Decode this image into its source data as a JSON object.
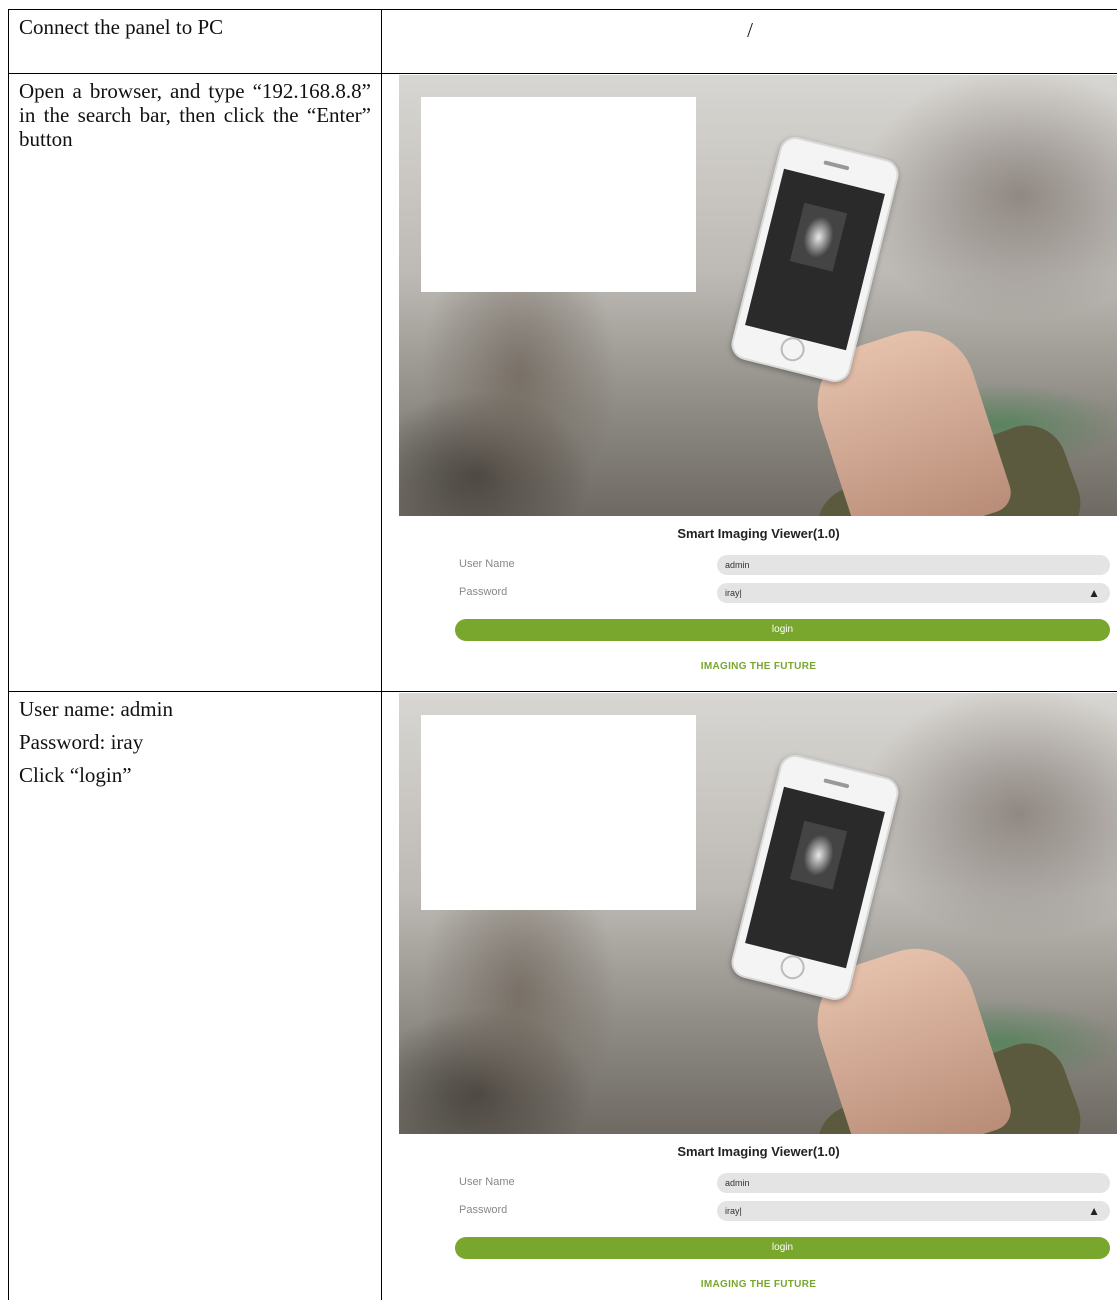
{
  "rows": [
    {
      "step": "Connect the panel to PC",
      "detail": "/"
    },
    {
      "step": "Open a browser, and type “192.168.8.8” in the search bar, then click the “Enter” button"
    },
    {
      "lines": [
        "User name: admin",
        "Password: iray",
        "Click “login”"
      ]
    }
  ],
  "login_page": {
    "title": "Smart Imaging Viewer(1.0)",
    "username_label": "User Name",
    "username_value": "admin",
    "password_label": "Password",
    "password_value": "iray|",
    "login_button": "login",
    "tagline": "IMAGING THE FUTURE",
    "accent_color": "#79a62c"
  }
}
